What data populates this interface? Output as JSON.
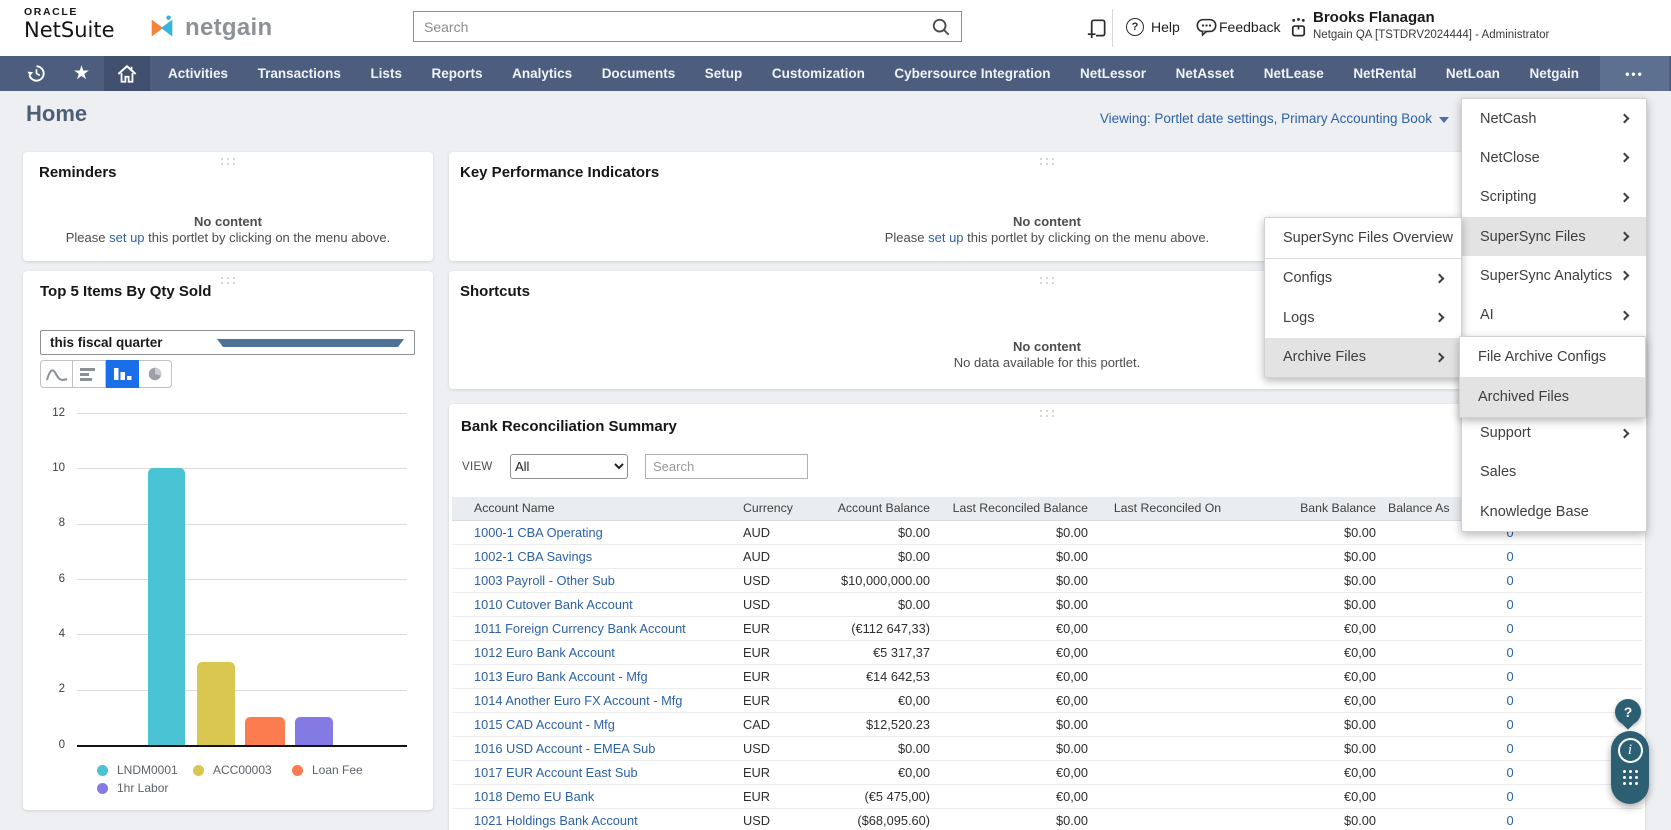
{
  "topbar": {
    "oracle_label": "ORACLE",
    "netsuite_label": "NetSuite",
    "brand_label": "netgain",
    "search": {
      "placeholder": "Search"
    },
    "help_label": "Help",
    "feedback_label": "Feedback",
    "user": {
      "name": "Brooks Flanagan",
      "role_line": "Netgain QA [TSTDRV2024444] - Administrator"
    }
  },
  "nav": {
    "items": [
      "Activities",
      "Transactions",
      "Lists",
      "Reports",
      "Analytics",
      "Documents",
      "Setup",
      "Customization",
      "Cybersource Integration",
      "NetLessor",
      "NetAsset",
      "NetLease",
      "NetRental",
      "NetLoan",
      "Netgain"
    ],
    "overflow_label": "•••"
  },
  "page": {
    "title": "Home",
    "viewing_label": "Viewing: Portlet date settings, Primary Accounting Book"
  },
  "portlets": {
    "reminders": {
      "title": "Reminders",
      "no_content": "No content",
      "setup_prefix": "Please ",
      "setup_link": "set up",
      "setup_suffix": " this portlet by clicking on the menu above."
    },
    "kpi": {
      "title": "Key Performance Indicators",
      "no_content": "No content",
      "setup_prefix": "Please ",
      "setup_link": "set up",
      "setup_suffix": " this portlet by clicking on the menu above."
    },
    "top5": {
      "title": "Top 5 Items By Qty Sold",
      "period_value": "this fiscal quarter"
    },
    "shortcuts": {
      "title": "Shortcuts",
      "no_content": "No content",
      "no_data": "No data available for this portlet."
    },
    "bankrec": {
      "title": "Bank Reconciliation Summary",
      "view_label": "VIEW",
      "view_value": "All",
      "search_placeholder": "Search",
      "columns": [
        "Account Name",
        "Currency",
        "Account Balance",
        "Last Reconciled Balance",
        "Last Reconciled On",
        "Bank Balance",
        "Balance As"
      ],
      "rows": [
        [
          "1000-1 CBA Operating",
          "AUD",
          "$0.00",
          "$0.00",
          "",
          "$0.00",
          "0"
        ],
        [
          "1002-1 CBA Savings",
          "AUD",
          "$0.00",
          "$0.00",
          "",
          "$0.00",
          "0"
        ],
        [
          "1003 Payroll - Other Sub",
          "USD",
          "$10,000,000.00",
          "$0.00",
          "",
          "$0.00",
          "0"
        ],
        [
          "1010 Cutover Bank Account",
          "USD",
          "$0.00",
          "$0.00",
          "",
          "$0.00",
          "0"
        ],
        [
          "1011 Foreign Currency Bank Account",
          "EUR",
          "(€112 647,33)",
          "€0,00",
          "",
          "€0,00",
          "0"
        ],
        [
          "1012 Euro Bank Account",
          "EUR",
          "€5 317,37",
          "€0,00",
          "",
          "€0,00",
          "0"
        ],
        [
          "1013 Euro Bank Account - Mfg",
          "EUR",
          "€14 642,53",
          "€0,00",
          "",
          "€0,00",
          "0"
        ],
        [
          "1014 Another Euro FX Account - Mfg",
          "EUR",
          "€0,00",
          "€0,00",
          "",
          "€0,00",
          "0"
        ],
        [
          "1015 CAD Account - Mfg",
          "CAD",
          "$12,520.23",
          "$0.00",
          "",
          "$0.00",
          "0"
        ],
        [
          "1016 USD Account - EMEA Sub",
          "USD",
          "$0.00",
          "$0.00",
          "",
          "$0.00",
          "0"
        ],
        [
          "1017 EUR Account East Sub",
          "EUR",
          "€0,00",
          "€0,00",
          "",
          "€0,00",
          "0"
        ],
        [
          "1018 Demo EU Bank",
          "EUR",
          "(€5 475,00)",
          "€0,00",
          "",
          "€0,00",
          "0"
        ],
        [
          "1021 Holdings Bank Account",
          "USD",
          "($68,095.60)",
          "$0.00",
          "",
          "$0.00",
          "0"
        ]
      ]
    }
  },
  "menus": {
    "netgain_menu": {
      "items": [
        {
          "label": "NetCash",
          "chevron": true
        },
        {
          "label": "NetClose",
          "chevron": true
        },
        {
          "label": "Scripting",
          "chevron": true
        },
        {
          "label": "SuperSync Files",
          "chevron": true,
          "highlighted": true
        },
        {
          "label": "SuperSync Analytics",
          "chevron": true
        },
        {
          "label": "AI",
          "chevron": true
        },
        {
          "label": "Support",
          "chevron": true
        },
        {
          "label": "Sales"
        },
        {
          "label": "Knowledge Base"
        }
      ]
    },
    "supersync_menu": {
      "items": [
        {
          "label": "SuperSync Files Overview",
          "separator_below": true
        },
        {
          "label": "Configs",
          "chevron": true
        },
        {
          "label": "Logs",
          "chevron": true
        },
        {
          "label": "Archive Files",
          "chevron": true,
          "highlighted": true
        }
      ]
    },
    "archive_menu": {
      "items": [
        {
          "label": "File Archive Configs"
        },
        {
          "label": "Archived Files",
          "highlighted": true
        }
      ]
    }
  },
  "chart_data": {
    "type": "bar",
    "title": "Top 5 Items By Qty Sold",
    "period": "this fiscal quarter",
    "categories": [
      "LNDM0001",
      "ACC00003",
      "Loan Fee",
      "1hr Labor"
    ],
    "values": [
      10,
      3,
      1,
      1
    ],
    "colors": [
      "#4ac3d4",
      "#d9c74f",
      "#fb7d4f",
      "#837ae4"
    ],
    "ylim": [
      0,
      12
    ],
    "ytick_step": 2,
    "xlabel": "",
    "ylabel": "",
    "grid": true,
    "legend_position": "bottom"
  },
  "colors": {
    "navbar": "#4c5d7e",
    "navbar_active_cell": "#404f6d",
    "navbar_overflow": "#5e7090",
    "link_blue": "#2e62a6",
    "menu_highlight": "#e3e3e3",
    "chart_button_active": "#1a6ee8",
    "floating_widget": "#2d5f72",
    "page_title": "#4e5f75"
  }
}
